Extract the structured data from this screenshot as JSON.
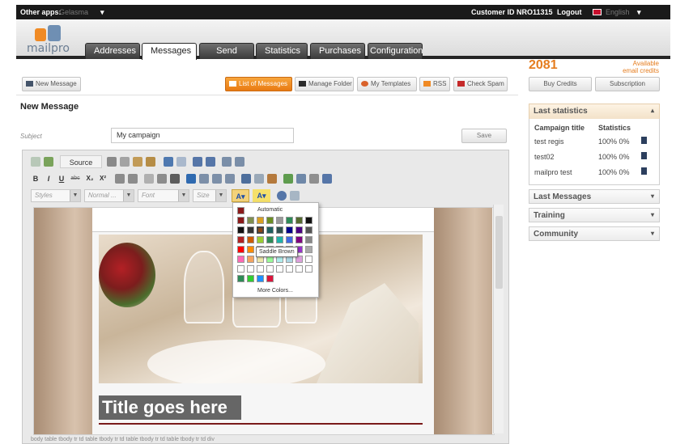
{
  "topbar": {
    "other_apps_label": "Other apps:",
    "other_apps_value": "Gelasma",
    "customer_id": "Customer ID NRO11315",
    "logout": "Logout",
    "language": "English"
  },
  "brand": {
    "logo_text": "mailpro",
    "accent": "#f08a24"
  },
  "tabs": [
    {
      "label": "Addresses",
      "active": false
    },
    {
      "label": "Messages",
      "active": true
    },
    {
      "label": "Send",
      "active": false
    },
    {
      "label": "Statistics",
      "active": false
    },
    {
      "label": "Purchases",
      "active": false
    },
    {
      "label": "Configuration",
      "active": false
    }
  ],
  "subnav": {
    "new_message": "New Message",
    "list_of_messages": "List of Messages",
    "manage_folder": "Manage Folder",
    "my_templates": "My Templates",
    "rss": "RSS",
    "check_spam": "Check Spam"
  },
  "credits": {
    "count": "2081",
    "label_line1": "Available",
    "label_line2": "email credits",
    "buy_credits": "Buy Credits",
    "subscription": "Subscription"
  },
  "form": {
    "heading": "New Message",
    "subject_label": "Subject",
    "subject_value": "My campaign",
    "save": "Save"
  },
  "editor": {
    "source_label": "Source",
    "styles": "Styles",
    "format": "Normal ...",
    "font": "Font",
    "size": "Size",
    "bold": "B",
    "italic": "I",
    "underline": "U",
    "strike": "abc",
    "subscript": "X₂",
    "superscript": "X²",
    "title_text": "Title goes here",
    "path": "body  table  tbody  tr  td  table  tbody  tr  td  table  tbody  tr  td  table  tbody  tr  td  div",
    "color_popup": {
      "automatic": "Automatic",
      "more_colors": "More Colors...",
      "tooltip": "Saddle Brown",
      "swatch_rows": [
        [
          "#8b1a1a",
          "#7f8f4f",
          "#d8a024",
          "#6b8e23",
          "#999999",
          "#2e8b57",
          "#556b2f",
          "#111111"
        ],
        [
          "#111111",
          "#333333",
          "#8b4513",
          "#1f5f5f",
          "#2f4f4f",
          "#00008b",
          "#4b0082",
          "#555555"
        ],
        [
          "#b22222",
          "#cd5c00",
          "#9acd32",
          "#2e8b57",
          "#20b2aa",
          "#4169e1",
          "#800080",
          "#888888"
        ],
        [
          "#ff0000",
          "#ff8c00",
          "#ffd700",
          "#32cd32",
          "#40e0d0",
          "#1e90ff",
          "#9932cc",
          "#aaaaaa"
        ],
        [
          "#ff69b4",
          "#f4a460",
          "#eee8aa",
          "#98fb98",
          "#afeeee",
          "#add8e6",
          "#dda0dd",
          "#ffffff"
        ],
        [
          "#ffffff",
          "#ffffff",
          "#ffffff",
          "#ffffff",
          "#ffffff",
          "#ffffff",
          "#ffffff",
          "#ffffff"
        ],
        [
          "#2e8b57",
          "#32cd32",
          "#1e90ff",
          "#dc143c"
        ]
      ]
    }
  },
  "sidebar": {
    "last_statistics": "Last statistics",
    "col_campaign": "Campaign title",
    "col_statistics": "Statistics",
    "rows": [
      {
        "title": "test regis",
        "stats": "100% 0%"
      },
      {
        "title": "test02",
        "stats": "100% 0%"
      },
      {
        "title": "mailpro test",
        "stats": "100% 0%"
      }
    ],
    "last_messages": "Last Messages",
    "training": "Training",
    "community": "Community"
  }
}
